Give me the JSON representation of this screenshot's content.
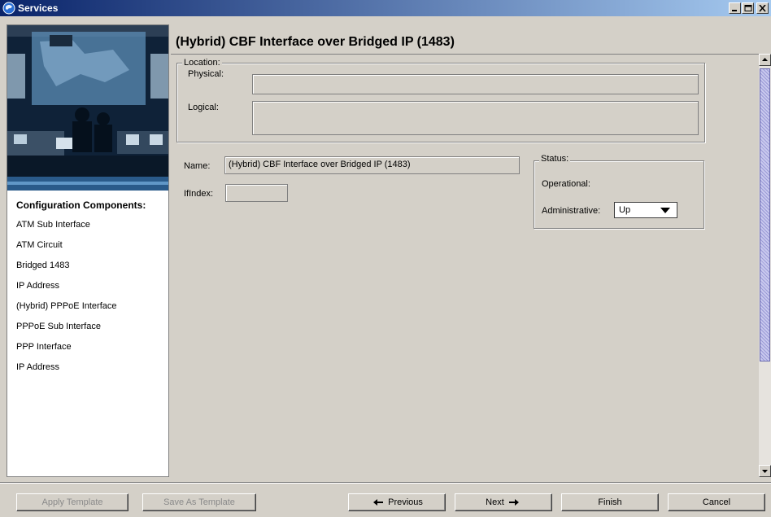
{
  "window": {
    "title": "Services"
  },
  "left_panel": {
    "heading": "Configuration Components:",
    "items": [
      {
        "label": "ATM Sub Interface"
      },
      {
        "label": "ATM Circuit"
      },
      {
        "label": "Bridged 1483"
      },
      {
        "label": "IP Address"
      },
      {
        "label": "(Hybrid) PPPoE Interface"
      },
      {
        "label": "PPPoE Sub Interface"
      },
      {
        "label": "PPP Interface"
      },
      {
        "label": "IP Address"
      }
    ]
  },
  "main": {
    "title": "(Hybrid) CBF Interface over Bridged IP (1483)",
    "location": {
      "legend": "Location:",
      "physical_label": "Physical:",
      "physical_value": "",
      "logical_label": "Logical:",
      "logical_value": ""
    },
    "name_label": "Name:",
    "name_value": "(Hybrid) CBF Interface over Bridged IP (1483)",
    "ifindex_label": "IfIndex:",
    "ifindex_value": "",
    "status": {
      "legend": "Status:",
      "operational_label": "Operational:",
      "operational_value": "",
      "administrative_label": "Administrative:",
      "administrative_value": "Up"
    }
  },
  "buttons": {
    "apply_template": "Apply Template",
    "save_as_template": "Save As Template",
    "previous": "Previous",
    "next": "Next",
    "finish": "Finish",
    "cancel": "Cancel"
  },
  "icons": {
    "app": "globe-icon",
    "minimize": "minimize-icon",
    "maximize": "maximize-icon",
    "close": "close-icon",
    "previous": "arrow-left-icon",
    "next": "arrow-right-icon",
    "scroll_up": "scroll-up-icon",
    "scroll_down": "scroll-down-icon",
    "dropdown": "dropdown-arrow-icon"
  },
  "colors": {
    "titlebar_start": "#0a246a",
    "titlebar_end": "#a6caf0",
    "window_bg": "#d4d0c8",
    "scroll_thumb": "#9b9bd6"
  }
}
